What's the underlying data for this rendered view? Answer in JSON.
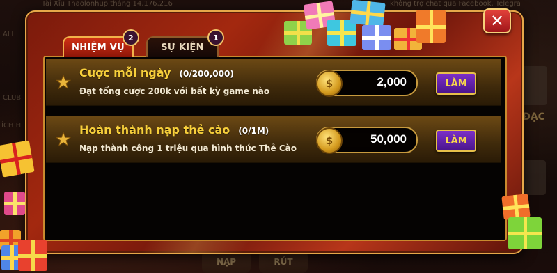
{
  "background": {
    "ticker_left": "Tài Xỉu Thaolonhup thắng 14,176,216",
    "ticker_right": "không trợ chat qua Facebook, Telegra",
    "side_labels": [
      "ALL",
      "CLUB",
      "ÍCH H"
    ],
    "right_label": "I ĐẠC",
    "bottom_buttons": [
      "NẠP",
      "RÚT"
    ]
  },
  "tabs": [
    {
      "label": "NHIỆM VỤ",
      "badge": "2",
      "active": true
    },
    {
      "label": "SỰ KIỆN",
      "badge": "1",
      "active": false
    }
  ],
  "close_label": "✕",
  "quests": [
    {
      "title": "Cược mỗi ngày",
      "progress": "(0/200,000)",
      "description": "Đạt tổng cược 200k với bất kỳ game nào",
      "reward": "2,000",
      "button": "LÀM"
    },
    {
      "title": "Hoàn thành nạp thẻ cào",
      "progress": "(0/1M)",
      "description": "Nạp thành công 1 triệu qua hình thức Thẻ Cào",
      "reward": "50,000",
      "button": "LÀM"
    }
  ],
  "colors": {
    "title_gold": "#f7cf3b",
    "button_purple": "#6a24b4",
    "frame_red": "#a3280f",
    "border_gold": "#e6a84a"
  },
  "icons": [
    "star-icon",
    "coin-icon",
    "close-icon",
    "gift-box-icon"
  ]
}
